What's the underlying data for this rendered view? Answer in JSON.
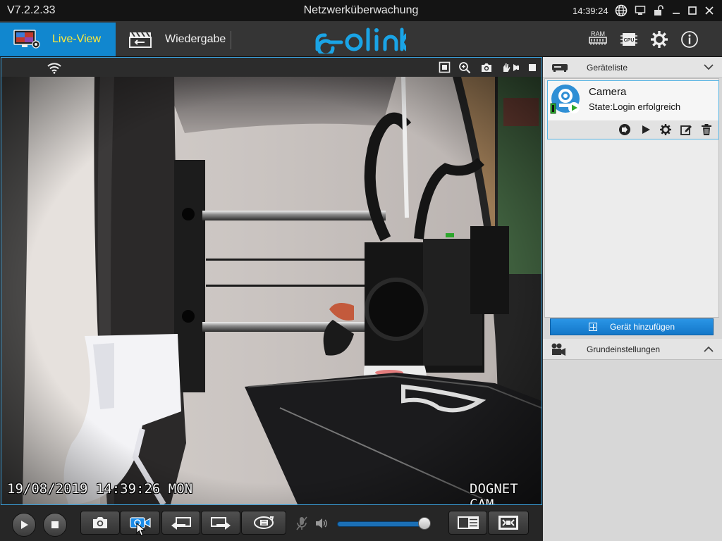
{
  "window": {
    "version": "V7.2.2.33",
    "title": "Netzwerküberwachung",
    "clock": "14:39:24"
  },
  "nav": {
    "live_label": "Live-View",
    "playback_label": "Wiedergabe",
    "logo_text": "reolink",
    "ram_label": "RAM",
    "cpu_label": "CPU",
    "icons": [
      "ram-icon",
      "cpu-icon",
      "gear-icon",
      "info-icon"
    ]
  },
  "video": {
    "osd_datetime": "19/08/2019 14:39:26 MON",
    "osd_camera_name": "DOGNET CAM",
    "top_icons": [
      "wifi-icon",
      "fit-screen-icon",
      "zoom-icon",
      "snapshot-icon",
      "ptz-icon",
      "stop-icon"
    ]
  },
  "toolbar": {
    "volume_level": 0.95,
    "buttons": [
      "play-icon",
      "stop-icon",
      "camera-icon",
      "record-icon",
      "previous-icon",
      "next-icon",
      "cycle-icon",
      "mute-icon",
      "speaker-icon",
      "layout-icon",
      "fullscreen-icon"
    ],
    "colors": {
      "accent": "#1187cf",
      "record_active": "#1a8be8"
    }
  },
  "panel": {
    "device_list_title": "Geräteliste",
    "device": {
      "name": "Camera",
      "state": "State:Login erfolgreich",
      "actions": [
        "open-icon",
        "play-icon",
        "settings-icon",
        "edit-icon",
        "delete-icon"
      ]
    },
    "add_device_label": "Gerät hinzufügen",
    "basic_settings_title": "Grundeinstellungen"
  }
}
